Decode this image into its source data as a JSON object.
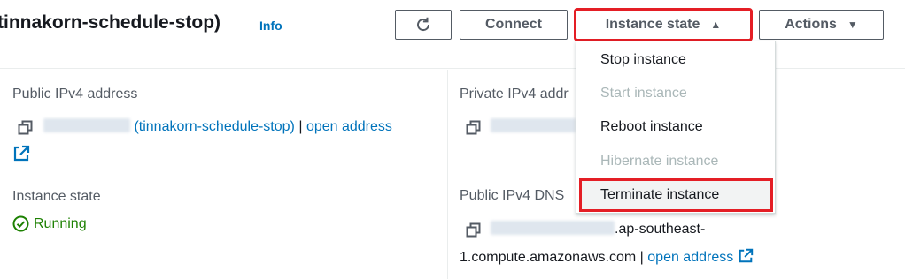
{
  "header": {
    "title": "tinnakorn-schedule-stop)",
    "info_label": "Info",
    "buttons": {
      "refresh_icon": "refresh-icon",
      "connect_label": "Connect",
      "instance_state_label": "Instance state",
      "actions_label": "Actions"
    }
  },
  "instance_state_menu": {
    "items": [
      {
        "label": "Stop instance",
        "enabled": true
      },
      {
        "label": "Start instance",
        "enabled": false
      },
      {
        "label": "Reboot instance",
        "enabled": true
      },
      {
        "label": "Hibernate instance",
        "enabled": false
      },
      {
        "label": "Terminate instance",
        "enabled": true,
        "highlighted": true
      }
    ]
  },
  "details": {
    "public_ipv4": {
      "label": "Public IPv4 address",
      "name_suffix": "(tinnakorn-schedule-stop)",
      "separator": "|",
      "open_address_label": "open address"
    },
    "private_ipv4": {
      "label": "Private IPv4 addr"
    },
    "instance_state": {
      "label": "Instance state",
      "value": "Running"
    },
    "public_ipv4_dns": {
      "label": "Public IPv4 DNS",
      "dns_suffix": ".ap-southeast-",
      "dns_line2": "1.compute.amazonaws.com",
      "separator": "|",
      "open_address_label": "open address"
    }
  },
  "colors": {
    "link": "#0073bb",
    "running": "#1d8102",
    "highlight_outline": "#e41e25",
    "disabled_text": "#aab7b8"
  }
}
